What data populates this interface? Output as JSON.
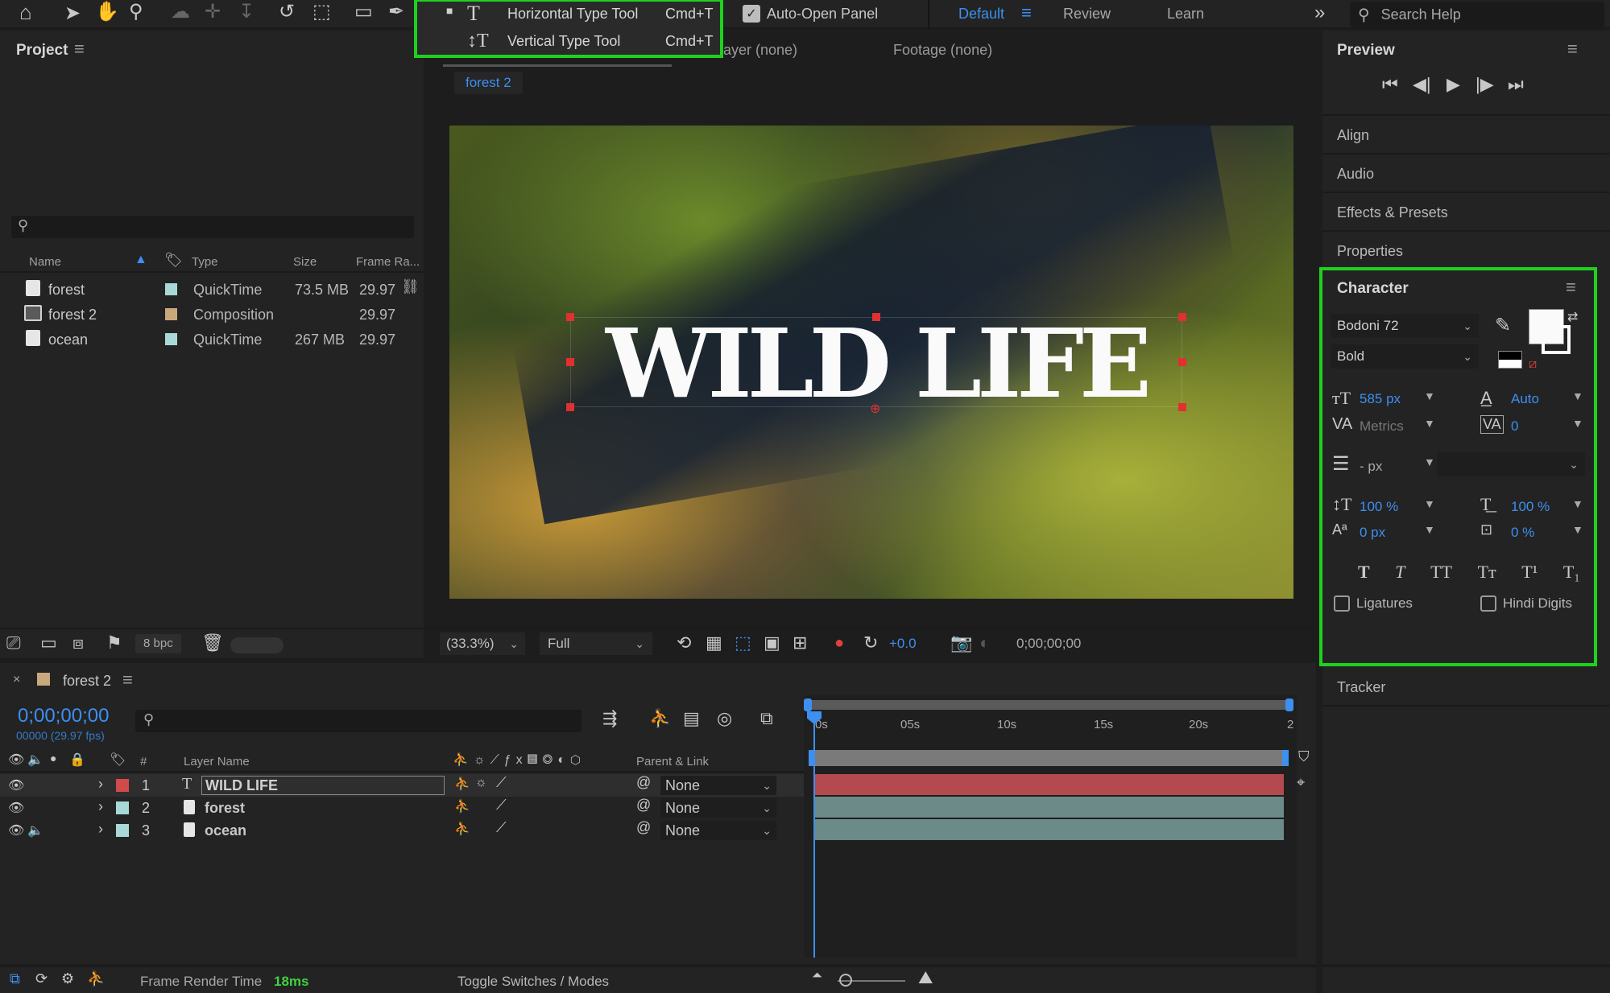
{
  "toolbar": {
    "auto_open_label": "Auto-Open Panel",
    "workspaces": [
      "Default",
      "Review",
      "Learn"
    ],
    "search_placeholder": "Search Help",
    "type_menu": [
      {
        "label": "Horizontal Type Tool",
        "shortcut": "Cmd+T"
      },
      {
        "label": "Vertical Type Tool",
        "shortcut": "Cmd+T"
      }
    ]
  },
  "project": {
    "title": "Project",
    "columns": [
      "Name",
      "Type",
      "Size",
      "Frame Ra..."
    ],
    "items": [
      {
        "name": "forest",
        "type": "QuickTime",
        "size": "73.5 MB",
        "fps": "29.97",
        "color": "#a8d8d8"
      },
      {
        "name": "forest 2",
        "type": "Composition",
        "size": "",
        "fps": "29.97",
        "color": "#c9a87c"
      },
      {
        "name": "ocean",
        "type": "QuickTime",
        "size": "267 MB",
        "fps": "29.97",
        "color": "#a8d8d8"
      }
    ],
    "bpc": "8 bpc"
  },
  "viewer": {
    "layer_tab": "ayer (none)",
    "footage_tab": "Footage (none)",
    "comp_chip": "forest 2",
    "overlay_text": "WILD LIFE",
    "zoom": "(33.3%)",
    "resolution": "Full",
    "exposure": "+0.0",
    "timecode": "0;00;00;00"
  },
  "right": {
    "preview_title": "Preview",
    "panels": [
      "Align",
      "Audio",
      "Effects & Presets",
      "Properties"
    ],
    "tracker": "Tracker"
  },
  "character": {
    "title": "Character",
    "font": "Bodoni 72",
    "style": "Bold",
    "size": "585 px",
    "leading": "Auto",
    "kerning": "Metrics",
    "tracking": "0",
    "stroke": "- px",
    "vscale": "100 %",
    "hscale": "100 %",
    "baseline": "0 px",
    "tsume": "0 %",
    "style_buttons": [
      "T",
      "T",
      "TT",
      "Tт",
      "T¹",
      "T₁"
    ],
    "ligatures": "Ligatures",
    "hindi": "Hindi Digits"
  },
  "timeline": {
    "comp_tab": "forest 2",
    "timecode": "0;00;00;00",
    "fps_note": "00000 (29.97 fps)",
    "columns": [
      "#",
      "Layer Name",
      "Parent & Link"
    ],
    "ruler": [
      "0s",
      "05s",
      "10s",
      "15s",
      "20s",
      "2"
    ],
    "layers": [
      {
        "num": "1",
        "name": "WILD LIFE",
        "parent": "None",
        "color": "#d24b4b",
        "bar": "#b24a4f"
      },
      {
        "num": "2",
        "name": "forest",
        "parent": "None",
        "color": "#a8d8d8",
        "bar": "#6b8a88"
      },
      {
        "num": "3",
        "name": "ocean",
        "parent": "None",
        "color": "#a8d8d8",
        "bar": "#6b8a88"
      }
    ]
  },
  "status": {
    "render_label": "Frame Render Time",
    "render_value": "18ms",
    "toggle": "Toggle Switches / Modes"
  },
  "colors": {
    "accent": "#3d8ff0",
    "highlight": "#1fd11f"
  }
}
